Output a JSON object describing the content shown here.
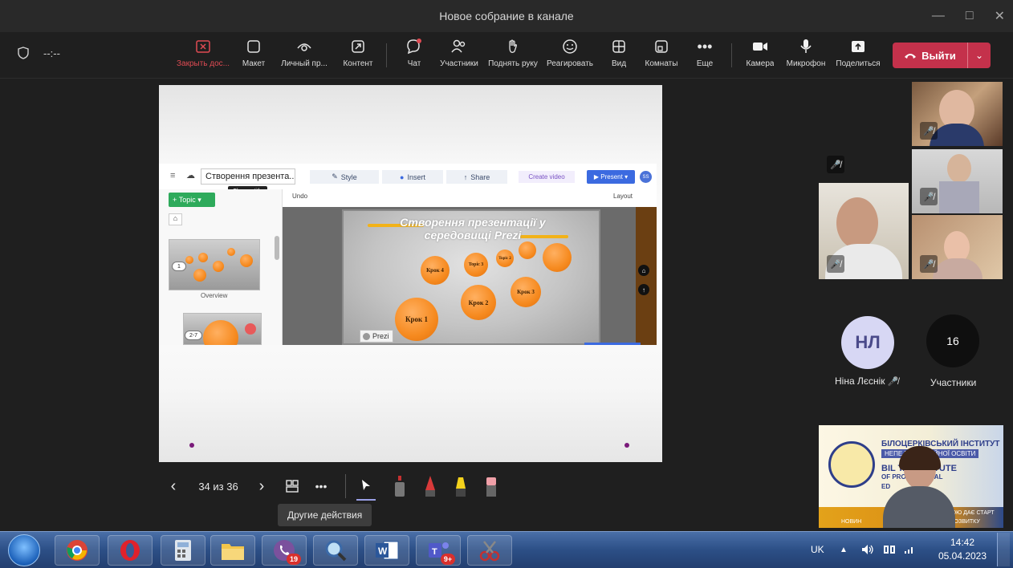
{
  "window": {
    "title": "Новое собрание в канале",
    "timer": "--:--"
  },
  "toolbar": {
    "close_share": "Закрыть дос...",
    "layout": "Макет",
    "personal": "Личный пр...",
    "content": "Контент",
    "chat": "Чат",
    "participants": "Участники",
    "raise_hand": "Поднять руку",
    "react": "Реагировать",
    "view": "Вид",
    "rooms": "Комнаты",
    "more": "Еще",
    "camera": "Камера",
    "mic": "Микрофон",
    "share": "Поделиться",
    "leave": "Выйти"
  },
  "slide": {
    "counter": "34 из 36",
    "tooltip": "Другие действия"
  },
  "prezi": {
    "title": "Створення презента...",
    "change_title_tip": "Change title",
    "style": "Style",
    "insert": "Insert",
    "share": "Share",
    "create_video": "Create video",
    "present": "Present",
    "avatar": "SS",
    "topic": "Topic",
    "undo": "Undo",
    "layout": "Layout",
    "overview": "Overview",
    "thumb1_num": "1",
    "thumb2_num": "2-7",
    "heading_line1": "Створення презентації у",
    "heading_line2": "середовищі Prezi",
    "krok1": "Крок 1",
    "krok2": "Крок 2",
    "krok3": "Крок 3",
    "krok4": "Крок 4",
    "topic3": "Topic 3",
    "topic2": "Topic 2",
    "logo": "Prezi"
  },
  "participants": {
    "nl_initials": "НЛ",
    "nl_name": "Ніна Лєснік",
    "count": "16",
    "count_label": "Участники"
  },
  "banner": {
    "line1": "БІЛОЦЕРКІВСЬКИЙ ІНСТИТУТ",
    "line2": "НЕПЕ         ПРОФЕСІЙНОЇ ОСВІТИ",
    "line3": "BIL          TA INSTITUTE",
    "line4": "OF              PROFESSIONAL",
    "line5": "ED",
    "line6": "ЮЮ ДАЄ СТАРТ",
    "line7": "РОЗВИТКУ",
    "line8": "НОВИН"
  },
  "taskbar": {
    "viber_badge": "19",
    "teams_badge": "9+",
    "lang": "UK",
    "time": "14:42",
    "date": "05.04.2023"
  },
  "colors": {
    "leave_red": "#c4314b",
    "prezi_orange": "#f68a1f",
    "prezi_green": "#2eaa5b",
    "prezi_blue": "#3b6ae0"
  }
}
